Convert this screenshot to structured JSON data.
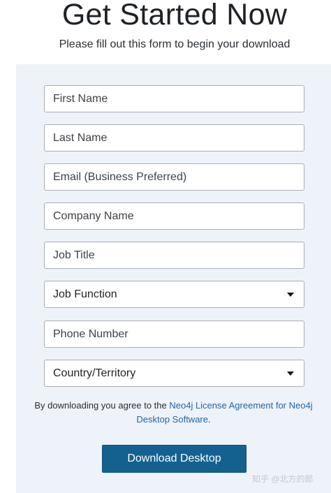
{
  "header": {
    "title": "Get Started Now",
    "subtitle": "Please fill out this form to begin your download"
  },
  "form": {
    "first_name_placeholder": "First Name",
    "last_name_placeholder": "Last Name",
    "email_placeholder": "Email (Business Preferred)",
    "company_placeholder": "Company Name",
    "job_title_placeholder": "Job Title",
    "job_function_selected": "Job Function",
    "phone_placeholder": "Phone Number",
    "country_selected": "Country/Territory"
  },
  "agreement": {
    "prefix": "By downloading you agree to the ",
    "link_text": "Neo4j License Agreement for Neo4j Desktop Software",
    "suffix": "."
  },
  "actions": {
    "download_label": "Download Desktop"
  },
  "watermark": {
    "text": "知乎 @北方的郎"
  },
  "colors": {
    "panel_background": "#eef2f9",
    "button_background": "#14618f",
    "link": "#1f66a8"
  }
}
